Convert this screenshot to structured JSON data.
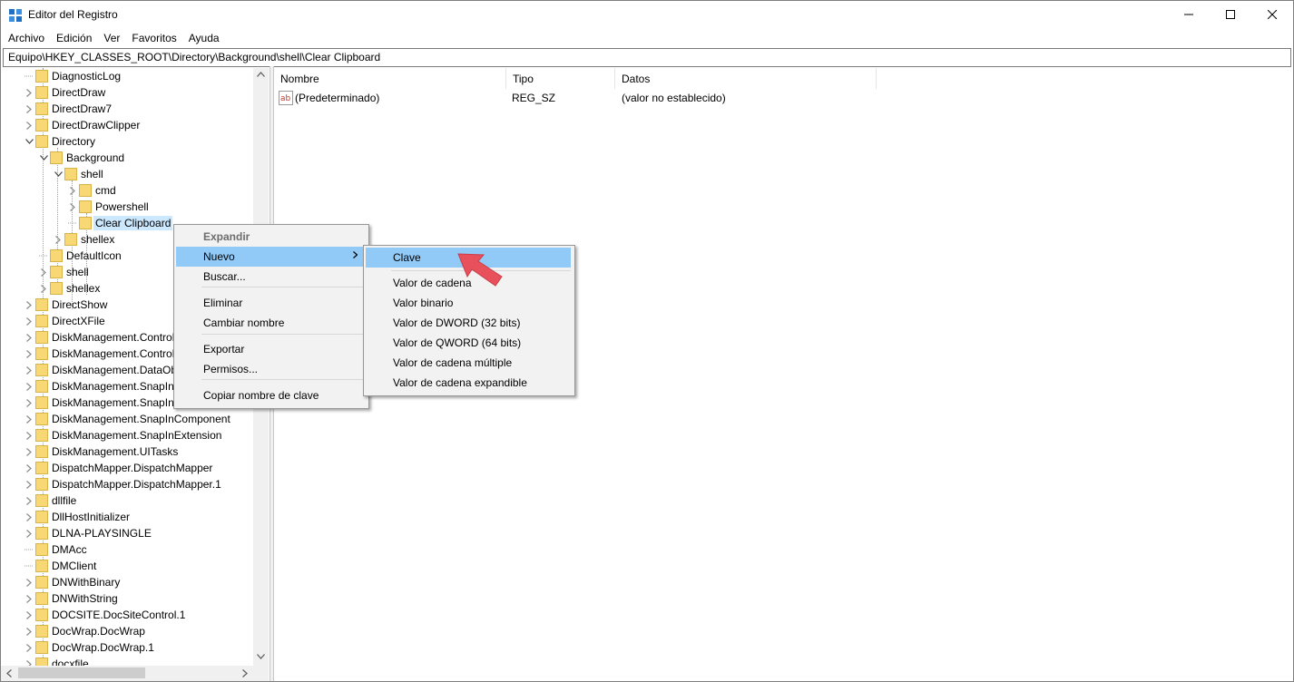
{
  "window": {
    "title": "Editor del Registro",
    "controls": {
      "minimize": "–",
      "maximize": "□",
      "close": "✕"
    }
  },
  "menubar": [
    "Archivo",
    "Edición",
    "Ver",
    "Favoritos",
    "Ayuda"
  ],
  "address": "Equipo\\HKEY_CLASSES_ROOT\\Directory\\Background\\shell\\Clear Clipboard",
  "tree": [
    {
      "label": "DiagnosticLog",
      "expander": "none"
    },
    {
      "label": "DirectDraw",
      "expander": "collapsed"
    },
    {
      "label": "DirectDraw7",
      "expander": "collapsed"
    },
    {
      "label": "DirectDrawClipper",
      "expander": "collapsed"
    },
    {
      "label": "Directory",
      "expander": "expanded"
    },
    {
      "label": "Background",
      "expander": "expanded"
    },
    {
      "label": "shell",
      "expander": "expanded"
    },
    {
      "label": "cmd",
      "expander": "collapsed"
    },
    {
      "label": "Powershell",
      "expander": "collapsed"
    },
    {
      "label": "Clear Clipboard",
      "expander": "none",
      "selected": true
    },
    {
      "label": "shellex",
      "expander": "collapsed"
    },
    {
      "label": "DefaultIcon",
      "expander": "none"
    },
    {
      "label": "shell",
      "expander": "collapsed"
    },
    {
      "label": "shellex",
      "expander": "collapsed"
    },
    {
      "label": "DirectShow",
      "expander": "collapsed"
    },
    {
      "label": "DirectXFile",
      "expander": "collapsed"
    },
    {
      "label": "DiskManagement.Control",
      "expander": "collapsed"
    },
    {
      "label": "DiskManagement.Control",
      "expander": "collapsed"
    },
    {
      "label": "DiskManagement.DataObject",
      "expander": "collapsed"
    },
    {
      "label": "DiskManagement.SnapIn",
      "expander": "collapsed"
    },
    {
      "label": "DiskManagement.SnapInAbout",
      "expander": "collapsed"
    },
    {
      "label": "DiskManagement.SnapInComponent",
      "expander": "collapsed"
    },
    {
      "label": "DiskManagement.SnapInExtension",
      "expander": "collapsed"
    },
    {
      "label": "DiskManagement.UITasks",
      "expander": "collapsed"
    },
    {
      "label": "DispatchMapper.DispatchMapper",
      "expander": "collapsed"
    },
    {
      "label": "DispatchMapper.DispatchMapper.1",
      "expander": "collapsed"
    },
    {
      "label": "dllfile",
      "expander": "collapsed"
    },
    {
      "label": "DllHostInitializer",
      "expander": "collapsed"
    },
    {
      "label": "DLNA-PLAYSINGLE",
      "expander": "collapsed"
    },
    {
      "label": "DMAcc",
      "expander": "none"
    },
    {
      "label": "DMClient",
      "expander": "none"
    },
    {
      "label": "DNWithBinary",
      "expander": "collapsed"
    },
    {
      "label": "DNWithString",
      "expander": "collapsed"
    },
    {
      "label": "DOCSITE.DocSiteControl.1",
      "expander": "collapsed"
    },
    {
      "label": "DocWrap.DocWrap",
      "expander": "collapsed"
    },
    {
      "label": "DocWrap.DocWrap.1",
      "expander": "collapsed"
    },
    {
      "label": "docxfile",
      "expander": "collapsed"
    }
  ],
  "list": {
    "columns": [
      "Nombre",
      "Tipo",
      "Datos"
    ],
    "rows": [
      {
        "name": "(Predeterminado)",
        "type": "REG_SZ",
        "data": "(valor no establecido)"
      }
    ]
  },
  "context_menu": {
    "items": [
      {
        "label": "Expandir",
        "state": "disabled"
      },
      {
        "label": "Nuevo",
        "state": "highlight",
        "submenu": true
      },
      {
        "label": "Buscar...",
        "state": "normal"
      },
      {
        "label": "Eliminar",
        "state": "normal"
      },
      {
        "label": "Cambiar nombre",
        "state": "normal"
      },
      {
        "label": "Exportar",
        "state": "normal"
      },
      {
        "label": "Permisos...",
        "state": "normal"
      },
      {
        "label": "Copiar nombre de clave",
        "state": "normal"
      }
    ]
  },
  "submenu": {
    "items": [
      {
        "label": "Clave",
        "state": "highlight"
      },
      {
        "label": "Valor de cadena",
        "state": "normal"
      },
      {
        "label": "Valor binario",
        "state": "normal"
      },
      {
        "label": "Valor de DWORD (32 bits)",
        "state": "normal"
      },
      {
        "label": "Valor de QWORD (64 bits)",
        "state": "normal"
      },
      {
        "label": "Valor de cadena múltiple",
        "state": "normal"
      },
      {
        "label": "Valor de cadena expandible",
        "state": "normal"
      }
    ]
  },
  "colors": {
    "selection": "#cce8ff",
    "menu_highlight": "#91c9f7",
    "pointer": "#e8505b",
    "folder": "#f8d775"
  }
}
